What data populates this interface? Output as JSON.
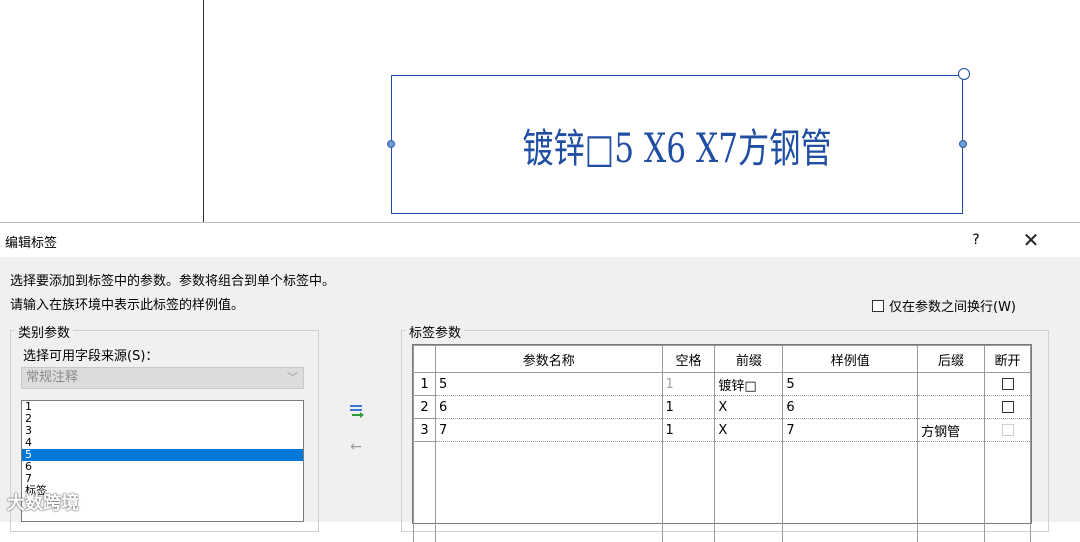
{
  "canvas": {
    "label_text": "镀锌□5 X6 X7方钢管"
  },
  "dialog": {
    "title": "编辑标签",
    "help_label": "?",
    "close_label": "✕",
    "instruction_1": "选择要添加到标签中的参数。参数将组合到单个标签中。",
    "instruction_2": "请输入在族环境中表示此标签的样例值。",
    "wrap_between_params_label": "仅在参数之间换行(W)",
    "category_group": {
      "title": "类别参数",
      "source_label": "选择可用字段来源(S)：",
      "source_value": "常规注释",
      "items": [
        {
          "label": "1",
          "selected": false
        },
        {
          "label": "2",
          "selected": false
        },
        {
          "label": "3",
          "selected": false
        },
        {
          "label": "4",
          "selected": false
        },
        {
          "label": "5",
          "selected": true
        },
        {
          "label": "6",
          "selected": false
        },
        {
          "label": "7",
          "selected": false
        },
        {
          "label": "标签",
          "selected": false
        }
      ]
    },
    "label_group": {
      "title": "标签参数",
      "columns": [
        "",
        "参数名称",
        "空格",
        "前缀",
        "样例值",
        "后缀",
        "断开"
      ],
      "rows": [
        {
          "num": "1",
          "name": "5",
          "space": "1",
          "prefix": "镀锌□",
          "sample": "5",
          "suffix": "",
          "break": false
        },
        {
          "num": "2",
          "name": "6",
          "space": "1",
          "prefix": "X",
          "sample": "6",
          "suffix": "",
          "break": false
        },
        {
          "num": "3",
          "name": "7",
          "space": "1",
          "prefix": "X",
          "sample": "7",
          "suffix": "方钢管",
          "break": false
        }
      ]
    }
  },
  "watermark": "大数跨境",
  "colors": {
    "accent": "#0078d7",
    "label_blue": "#1f4ea3"
  },
  "icons": [
    "add-parameter-icon",
    "remove-parameter-icon",
    "close-icon",
    "help-icon"
  ]
}
